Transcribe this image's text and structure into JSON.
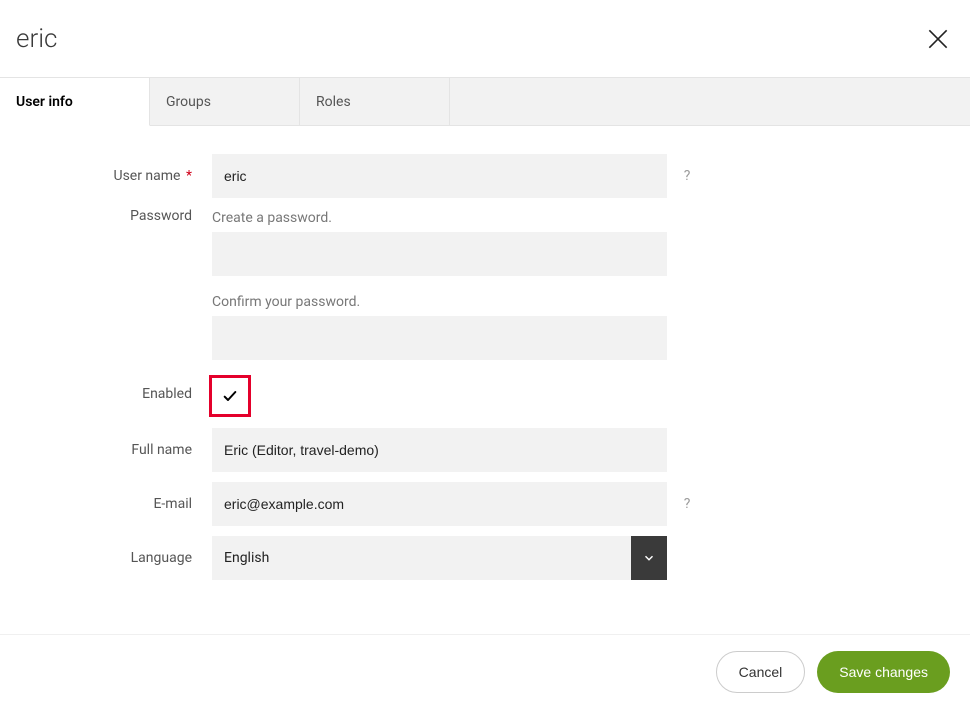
{
  "header": {
    "title": "eric"
  },
  "tabs": [
    {
      "label": "User info",
      "active": true
    },
    {
      "label": "Groups",
      "active": false
    },
    {
      "label": "Roles",
      "active": false
    }
  ],
  "form": {
    "username": {
      "label": "User name",
      "required": true,
      "value": "eric",
      "help": "?"
    },
    "password": {
      "label": "Password",
      "create_hint": "Create a password.",
      "confirm_hint": "Confirm your password.",
      "value": "",
      "confirm_value": ""
    },
    "enabled": {
      "label": "Enabled",
      "checked": true
    },
    "fullname": {
      "label": "Full name",
      "value": "Eric (Editor, travel-demo)"
    },
    "email": {
      "label": "E-mail",
      "value": "eric@example.com",
      "help": "?"
    },
    "language": {
      "label": "Language",
      "value": "English"
    }
  },
  "footer": {
    "cancel": "Cancel",
    "save": "Save changes"
  }
}
